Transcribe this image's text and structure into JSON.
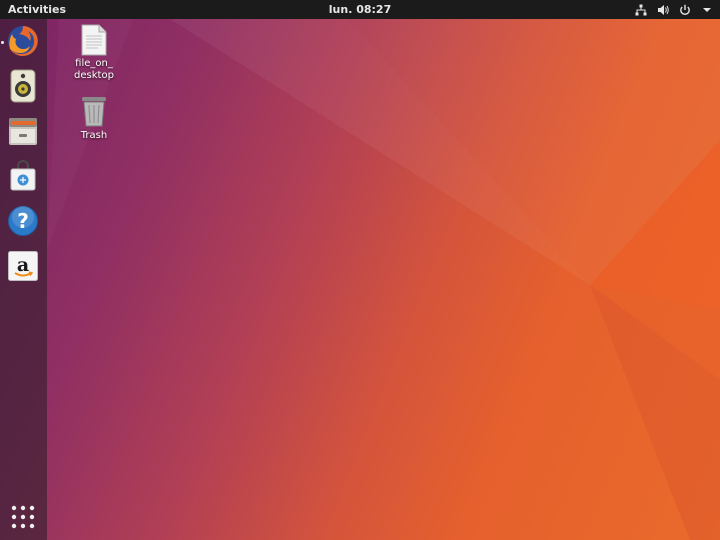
{
  "topbar": {
    "activities_label": "Activities",
    "clock": "lun. 08:27",
    "tray_icons": [
      "network-icon",
      "volume-icon",
      "power-icon",
      "chevron-down-icon"
    ]
  },
  "dock": {
    "items": [
      {
        "name": "firefox",
        "icon": "firefox-icon"
      },
      {
        "name": "rhythmbox",
        "icon": "speaker-icon"
      },
      {
        "name": "files",
        "icon": "file-cabinet-icon"
      },
      {
        "name": "software",
        "icon": "shopping-bag-icon"
      },
      {
        "name": "help",
        "icon": "question-mark-icon"
      },
      {
        "name": "amazon",
        "icon": "amazon-icon"
      }
    ],
    "show_apps_icon": "grid-icon"
  },
  "desktop": {
    "icons": [
      {
        "label": "file_on_\ndesktop",
        "icon": "document-icon"
      },
      {
        "label": "Trash",
        "icon": "trash-icon"
      }
    ]
  },
  "colors": {
    "topbar_bg": "#1b1b1b",
    "wallpaper_left": "#7b2266",
    "wallpaper_right": "#ea6a2c",
    "firefox_orange": "#e8672b",
    "help_blue": "#2b79c9"
  }
}
